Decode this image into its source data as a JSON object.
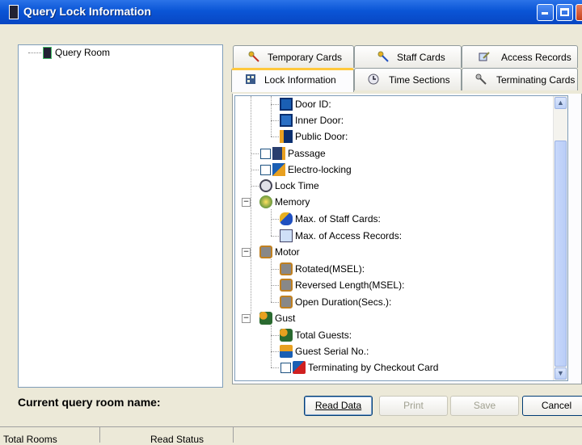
{
  "window": {
    "title": "Query Lock Information"
  },
  "left_tree": {
    "root_label": "Query Room"
  },
  "tabs_row1": [
    {
      "label": "Temporary Cards",
      "icon": "key-icon"
    },
    {
      "label": "Staff Cards",
      "icon": "key-icon"
    },
    {
      "label": "Access Records",
      "icon": "records-icon"
    }
  ],
  "tabs_row2": [
    {
      "label": "Lock Information",
      "icon": "building-icon",
      "active": true
    },
    {
      "label": "Time Sections",
      "icon": "clock-icon"
    },
    {
      "label": "Terminating Cards",
      "icon": "key-icon"
    }
  ],
  "tree": [
    {
      "label": "Door ID:"
    },
    {
      "label": "Inner Door:"
    },
    {
      "label": "Public Door:"
    },
    {
      "label": "Passage",
      "checked": false
    },
    {
      "label": "Electro-locking",
      "checked": false
    },
    {
      "label": "Lock Time"
    },
    {
      "label": "Memory",
      "expanded": true
    },
    {
      "label": "Max. of Staff Cards:"
    },
    {
      "label": "Max. of Access Records:"
    },
    {
      "label": "Motor",
      "expanded": true
    },
    {
      "label": "Rotated(MSEL):"
    },
    {
      "label": "Reversed Length(MSEL):"
    },
    {
      "label": "Open Duration(Secs.):"
    },
    {
      "label": "Gust",
      "expanded": true
    },
    {
      "label": "Total Guests:"
    },
    {
      "label": "Guest Serial No.:"
    },
    {
      "label": "Terminating by Checkout Card",
      "checked": false
    }
  ],
  "bottom": {
    "current_room_label": "Current query room name:",
    "read_button": "Read Data",
    "print_button": "Print",
    "save_button": "Save",
    "cancel_button": "Cancel"
  },
  "status": {
    "total_rooms": "Total Rooms",
    "read_status": "Read Status"
  },
  "colors": {
    "title_bar": "#0a55d6",
    "active_tab_accent": "#ffc83c"
  }
}
